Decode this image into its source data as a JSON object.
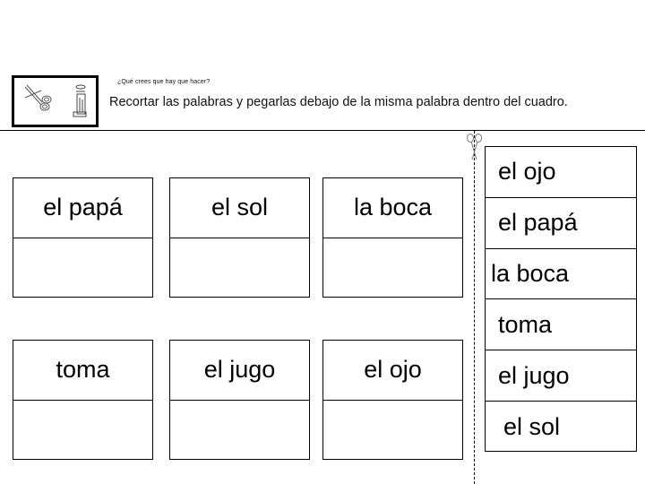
{
  "header": {
    "question": "¿Qué crees que hay que hacer?",
    "instruction": "Recortar las palabras  y pegarlas debajo de la misma palabra dentro del cuadro.",
    "icons": [
      "scissors-icon",
      "glue-stick-icon"
    ]
  },
  "cards": [
    {
      "word": "el papá"
    },
    {
      "word": "el sol"
    },
    {
      "word": "la boca"
    },
    {
      "word": "toma"
    },
    {
      "word": "el jugo"
    },
    {
      "word": "el ojo"
    }
  ],
  "cutout_strip": {
    "icon": "scissors-icon",
    "words": [
      "el ojo",
      "el papá",
      "la boca",
      "toma",
      "el jugo",
      "el sol"
    ]
  }
}
